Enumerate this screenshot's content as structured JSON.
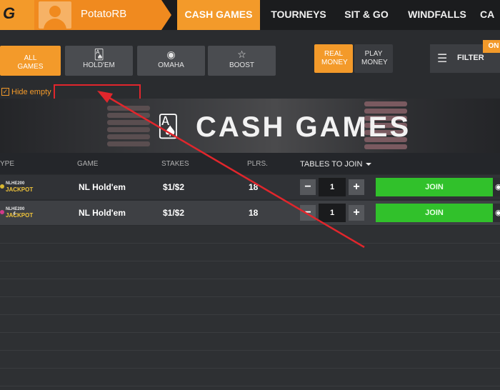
{
  "nav": {
    "username": "PotatoRB",
    "tabs": [
      {
        "label": "CASH GAMES",
        "active": true
      },
      {
        "label": "TOURNEYS",
        "active": false
      },
      {
        "label": "SIT & GO",
        "active": false
      },
      {
        "label": "WINDFALLS",
        "active": false
      },
      {
        "label": "CA",
        "active": false
      }
    ]
  },
  "filters": {
    "all_games": "ALL GAMES",
    "holdem": "HOLD'EM",
    "omaha": "OMAHA",
    "boost": "BOOST",
    "real_money": "REAL MONEY",
    "play_money": "PLAY MONEY",
    "filter": "FILTER",
    "filter_state": "ON"
  },
  "hide_empty": {
    "label": "Hide empty",
    "checked": true
  },
  "banner": {
    "title": "CASH GAMES"
  },
  "table": {
    "headers": {
      "type": "YPE",
      "game": "GAME",
      "stakes": "STAKES",
      "players": "PLRS.",
      "tables_to_join": "TABLES TO JOIN"
    },
    "rows": [
      {
        "badge_top": "NLHE200",
        "badge_bottom": "JACKPOT",
        "game": "NL Hold'em",
        "stakes": "$1/$2",
        "players": "18",
        "tables": "1",
        "join": "JOIN"
      },
      {
        "badge_top": "NLHE200",
        "badge_bottom": "JACKPOT",
        "game": "NL Hold'em",
        "stakes": "$1/$2",
        "players": "18",
        "tables": "1",
        "join": "JOIN"
      }
    ]
  },
  "colors": {
    "accent": "#f39a2a",
    "join": "#31c12b",
    "annotation": "#e1262c"
  }
}
